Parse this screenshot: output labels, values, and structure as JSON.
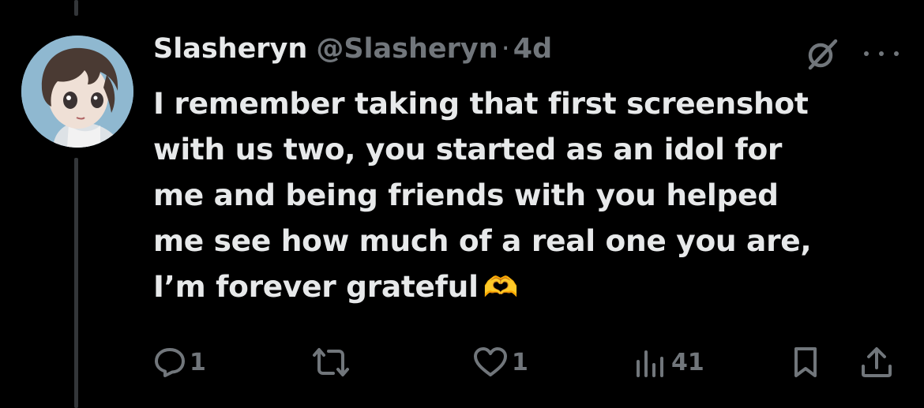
{
  "author": {
    "display_name": "Slasheryn",
    "handle": "@Slasheryn",
    "separator": "·",
    "time": "4d"
  },
  "tweet": {
    "text": "I remember taking that first screenshot\nwith us two, you started as an idol for\nme and being friends with you helped\nme see how much of a real one you are,\nI’m forever grateful",
    "emoji": "🫶"
  },
  "actions": {
    "replies": "1",
    "reposts": "",
    "likes": "1",
    "views": "41"
  },
  "icons": {
    "grok": "grok-icon",
    "more": "more-options-icon",
    "reply": "reply-icon",
    "repost": "repost-icon",
    "like": "heart-icon",
    "views": "views-icon",
    "bookmark": "bookmark-icon",
    "share": "share-icon"
  },
  "colors": {
    "background": "#000000",
    "primary_text": "#e7e9ea",
    "secondary_text": "#71767b",
    "thread_line": "#333639"
  }
}
